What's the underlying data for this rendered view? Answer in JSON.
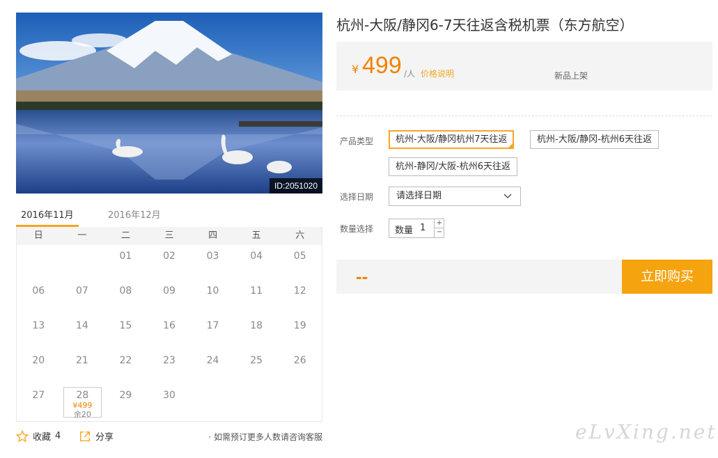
{
  "product": {
    "title": "杭州-大阪/静冈6-7天往返含税机票（东方航空）",
    "image_id": "ID:2051020"
  },
  "price": {
    "currency": "¥",
    "value": "499",
    "unit": "/人",
    "note_link": "价格说明",
    "badge": "新品上架"
  },
  "calendar": {
    "tabs": [
      "2016年11月",
      "2016年12月"
    ],
    "active_tab": 0,
    "weekdays": [
      "日",
      "一",
      "二",
      "三",
      "四",
      "五",
      "六"
    ],
    "days": [
      {
        "d": ""
      },
      {
        "d": ""
      },
      {
        "d": "01"
      },
      {
        "d": "02"
      },
      {
        "d": "03"
      },
      {
        "d": "04"
      },
      {
        "d": "05"
      },
      {
        "d": "06"
      },
      {
        "d": "07"
      },
      {
        "d": "08"
      },
      {
        "d": "09"
      },
      {
        "d": "10"
      },
      {
        "d": "11"
      },
      {
        "d": "12"
      },
      {
        "d": "13"
      },
      {
        "d": "14"
      },
      {
        "d": "15"
      },
      {
        "d": "16"
      },
      {
        "d": "17"
      },
      {
        "d": "18"
      },
      {
        "d": "19"
      },
      {
        "d": "20"
      },
      {
        "d": "21"
      },
      {
        "d": "22"
      },
      {
        "d": "23"
      },
      {
        "d": "24"
      },
      {
        "d": "25"
      },
      {
        "d": "26"
      },
      {
        "d": "27"
      },
      {
        "d": "28",
        "price": "¥499",
        "stock": "余20"
      },
      {
        "d": "29"
      },
      {
        "d": "30"
      }
    ]
  },
  "actions": {
    "favorite_label": "收藏",
    "favorite_count": "4",
    "share_label": "分享",
    "notice": "· 如需预订更多人数请咨询客服"
  },
  "form": {
    "type_label": "产品类型",
    "type_options": [
      "杭州-大阪/静冈杭州7天往返",
      "杭州-大阪/静冈-杭州6天往返",
      "杭州-静冈/大阪-杭州6天往返"
    ],
    "date_label": "选择日期",
    "date_placeholder": "请选择日期",
    "qty_label": "数量选择",
    "qty_field_label": "数量",
    "qty_value": "1",
    "qty_plus": "+",
    "qty_minus": "−"
  },
  "buy": {
    "total": "--",
    "button": "立即购买"
  },
  "watermark": "eLvXing.net",
  "colors": {
    "accent": "#f08300",
    "button": "#f5a30f",
    "border_selected": "#f5a623"
  }
}
